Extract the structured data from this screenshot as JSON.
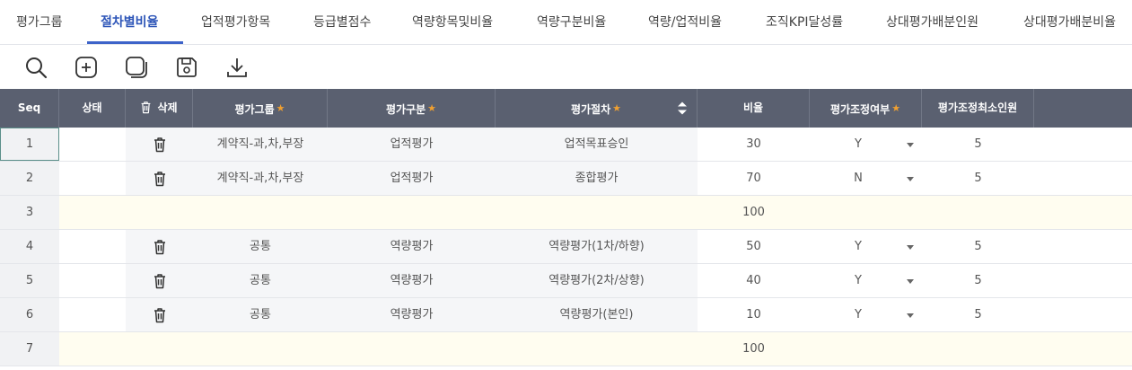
{
  "tabs": [
    {
      "label": "평가그룹",
      "active": false
    },
    {
      "label": "절차별비율",
      "active": true
    },
    {
      "label": "업적평가항목",
      "active": false
    },
    {
      "label": "등급별점수",
      "active": false
    },
    {
      "label": "역량항목및비율",
      "active": false
    },
    {
      "label": "역량구분비율",
      "active": false
    },
    {
      "label": "역량/업적비율",
      "active": false
    },
    {
      "label": "조직KPI달성률",
      "active": false
    },
    {
      "label": "상대평가배분인원",
      "active": false
    },
    {
      "label": "상대평가배분비율",
      "active": false
    }
  ],
  "toolbar": [
    {
      "icon": "search-icon",
      "tooltip": ""
    },
    {
      "icon": "add-icon",
      "tooltip": ""
    },
    {
      "icon": "copy-icon",
      "tooltip": ""
    },
    {
      "icon": "save-icon",
      "tooltip": ""
    },
    {
      "icon": "download-icon",
      "tooltip": ""
    }
  ],
  "grid": {
    "headers": {
      "seq": "Seq",
      "status": "상태",
      "delete": "삭제",
      "group": "평가그룹",
      "category": "평가구분",
      "procedure": "평가절차",
      "ratio": "비율",
      "adjust": "평가조정여부",
      "min": "평가조정최소인원"
    },
    "required_marker": "★",
    "rows": [
      {
        "seq": "1",
        "status": "",
        "deletable": true,
        "group": "계약직-과,차,부장",
        "category": "업적평가",
        "procedure": "업적목표승인",
        "ratio": "30",
        "adjust": "Y",
        "min": "5",
        "kind": "detail"
      },
      {
        "seq": "2",
        "status": "",
        "deletable": true,
        "group": "계약직-과,차,부장",
        "category": "업적평가",
        "procedure": "종합평가",
        "ratio": "70",
        "adjust": "N",
        "min": "5",
        "kind": "detail"
      },
      {
        "seq": "3",
        "status": "",
        "deletable": false,
        "group": "",
        "category": "",
        "procedure": "",
        "ratio": "100",
        "adjust": "",
        "min": "",
        "kind": "subtotal"
      },
      {
        "seq": "4",
        "status": "",
        "deletable": true,
        "group": "공통",
        "category": "역량평가",
        "procedure": "역량평가(1차/하향)",
        "ratio": "50",
        "adjust": "Y",
        "min": "5",
        "kind": "detail"
      },
      {
        "seq": "5",
        "status": "",
        "deletable": true,
        "group": "공통",
        "category": "역량평가",
        "procedure": "역량평가(2차/상향)",
        "ratio": "40",
        "adjust": "Y",
        "min": "5",
        "kind": "detail"
      },
      {
        "seq": "6",
        "status": "",
        "deletable": true,
        "group": "공통",
        "category": "역량평가",
        "procedure": "역량평가(본인)",
        "ratio": "10",
        "adjust": "Y",
        "min": "5",
        "kind": "detail"
      },
      {
        "seq": "7",
        "status": "",
        "deletable": false,
        "group": "",
        "category": "",
        "procedure": "",
        "ratio": "100",
        "adjust": "",
        "min": "",
        "kind": "subtotal"
      }
    ]
  },
  "colors": {
    "accent": "#3d63c9",
    "header_bg": "#5a6070",
    "required_star": "#f0a030",
    "subtotal_bg": "#fffdf0"
  }
}
